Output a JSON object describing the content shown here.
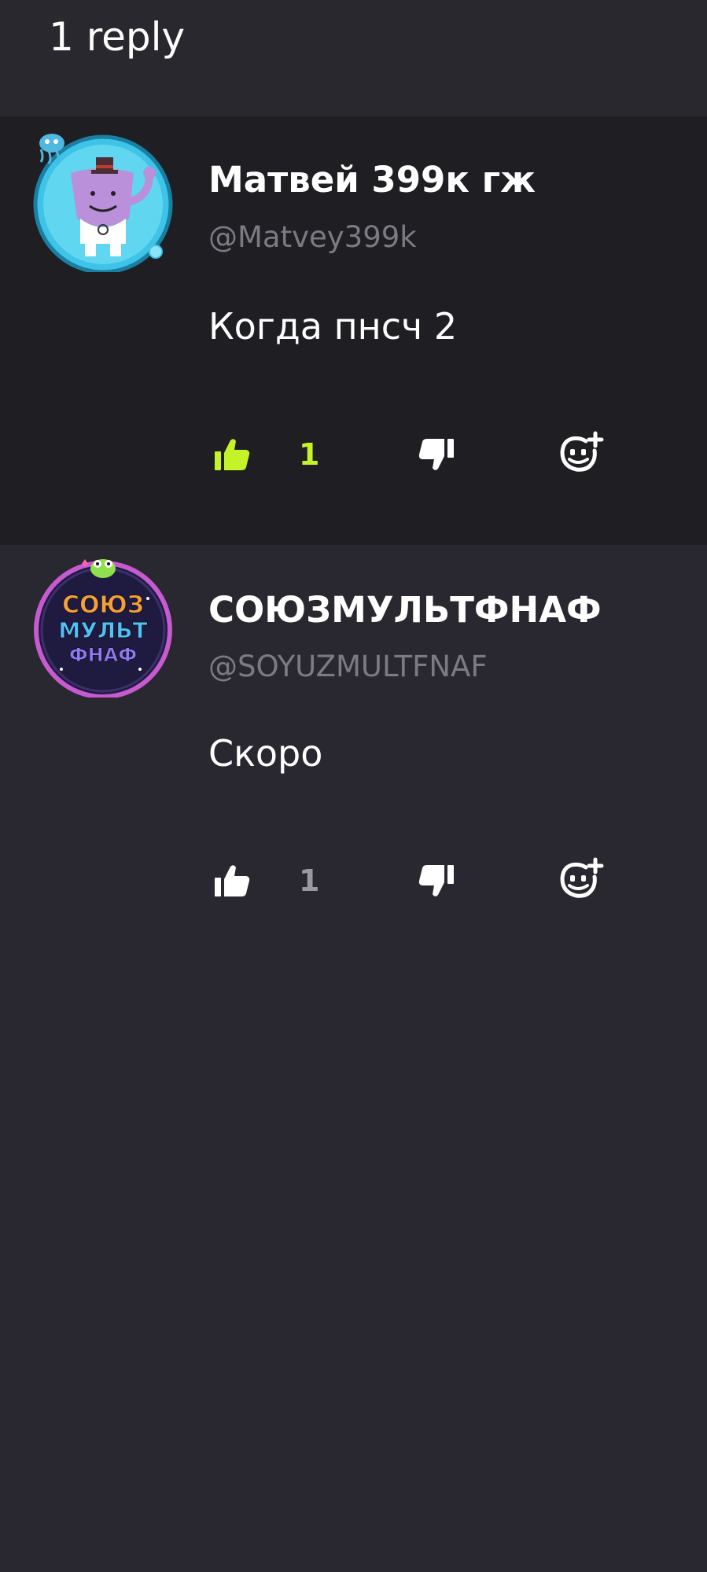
{
  "header": {
    "title": "1 reply"
  },
  "colors": {
    "like_active": "#c5f32a",
    "icon_white": "#ffffff",
    "count_inactive": "#9a98a0"
  },
  "comments": [
    {
      "author": "Матвей 399к гж",
      "handle": "@Matvey399k",
      "text": "Когда пнсч 2",
      "likes": "1",
      "liked": true,
      "avatar_icon": "monster-character-avatar-icon"
    },
    {
      "author": "СОЮЗМУЛЬТФНАФ",
      "handle": "@SOYUZMULTFNAF",
      "text": "Скоро",
      "likes": "1",
      "liked": false,
      "avatar_icon": "soyuzmultfnaf-logo-avatar-icon",
      "avatar_logo_lines": [
        "СОЮЗ",
        "МУЛЬТ",
        "ФНАФ"
      ]
    }
  ]
}
